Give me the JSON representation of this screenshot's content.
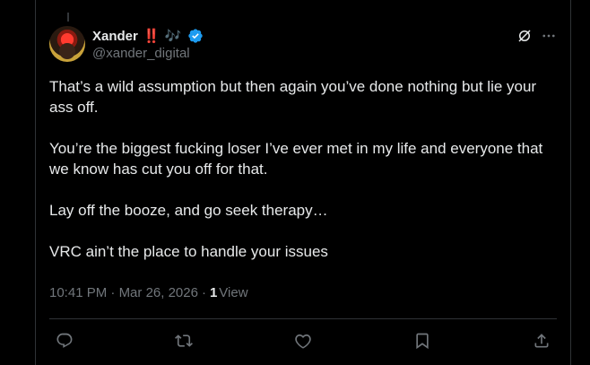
{
  "tweet": {
    "author": {
      "display_name": "Xander",
      "emoji_bang": "‼️",
      "emoji_notes": "🎶",
      "handle": "@xander_digital",
      "verified": true
    },
    "paragraphs": [
      "That’s a wild assumption but then again you’ve done nothing but lie your ass off.",
      "You’re the biggest fucking loser I’ve ever met in my life and everyone that we know has cut you off for that.",
      "Lay off the booze, and go seek therapy…",
      "VRC ain’t the place to handle your issues"
    ],
    "time": "10:41 PM",
    "separator": "·",
    "date": "Mar 26, 2026",
    "views_count": "1",
    "views_label": "View"
  },
  "actions": {
    "reply_icon": "reply-icon",
    "repost_icon": "repost-icon",
    "like_icon": "like-icon",
    "bookmark_icon": "bookmark-icon",
    "share_icon": "share-icon"
  },
  "colors": {
    "background": "#000000",
    "text": "#e7e9ea",
    "muted": "#71767b",
    "verified": "#1d9bf0",
    "border": "#2f3336"
  }
}
